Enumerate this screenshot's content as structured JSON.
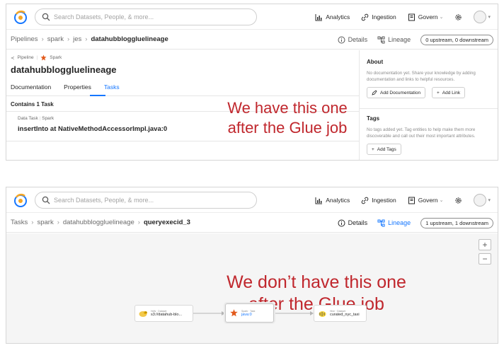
{
  "nav": {
    "search_placeholder": "Search Datasets, People, & more...",
    "analytics": "Analytics",
    "ingestion": "Ingestion",
    "govern": "Govern"
  },
  "panel1": {
    "breadcrumbs": [
      "Pipelines",
      "spark",
      "jes",
      "datahubbloggluelineage"
    ],
    "tabs": {
      "details": "Details",
      "lineage": "Lineage",
      "stream": "0 upstream, 0 downstream"
    },
    "entity_type": "Pipeline",
    "platform": "Spark",
    "title": "datahubbloggluelineage",
    "subtabs": [
      "Documentation",
      "Properties",
      "Tasks"
    ],
    "contains": "Contains 1 Task",
    "task_type": "Data Task",
    "task_platform": "Spark",
    "task_name": "insertInto at NativeMethodAccessorImpl.java:0",
    "annotation": "We have this one after the Glue job",
    "about": {
      "title": "About",
      "text": "No documentation yet. Share your knowledge by adding documentation and links to helpful resources.",
      "add_doc": "Add Documentation",
      "add_link": "Add Link"
    },
    "tags": {
      "title": "Tags",
      "text": "No tags added yet. Tag entities to help make them more discoverable and call out their most important attributes.",
      "add_tags": "Add Tags"
    }
  },
  "panel2": {
    "breadcrumbs": [
      "Tasks",
      "spark",
      "datahubbloggluelineage",
      "queryexecid_3"
    ],
    "tabs": {
      "details": "Details",
      "lineage": "Lineage",
      "stream": "1 upstream, 1 downstream"
    },
    "annotation": "We don’t have this one after the Glue job",
    "zoom_in": "+",
    "zoom_out": "−",
    "nodes": [
      {
        "meta": "Hdfs · Dataset",
        "name": "s3://datahub-blo..."
      },
      {
        "meta": "Spark · Task",
        "name": "java:0"
      },
      {
        "meta": "Hive · Dataset",
        "name": "curated_nyc_taxi"
      }
    ]
  },
  "colors": {
    "accent": "#1677ff",
    "annotation": "#c0272d",
    "spark": "#e25a1c"
  }
}
